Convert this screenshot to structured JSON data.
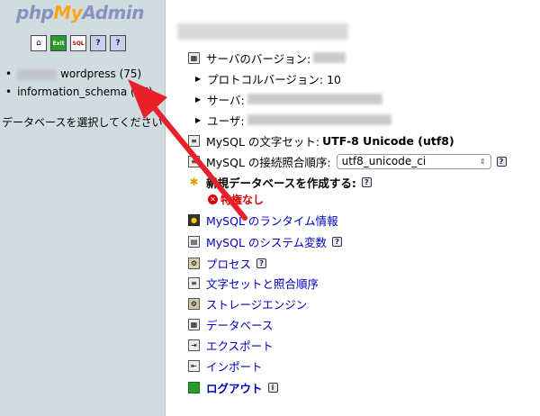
{
  "logo": {
    "php": "php",
    "my": "My",
    "admin": "Admin"
  },
  "iconbar": [
    {
      "name": "home-icon",
      "glyph": "⌂"
    },
    {
      "name": "exit-icon",
      "glyph": "Exit"
    },
    {
      "name": "sql-icon",
      "glyph": "SQL"
    },
    {
      "name": "query-window-icon",
      "glyph": "?"
    },
    {
      "name": "documentation-icon",
      "glyph": "?"
    }
  ],
  "sidebar": {
    "databases": [
      {
        "label": "wordpress (75)"
      },
      {
        "label": "information_schema (17)"
      }
    ],
    "select_message": "データベースを選択してください"
  },
  "main": {
    "server_version": "サーバのバージョン:",
    "protocol_version": "プロトコルバージョン: 10",
    "server": "サーバ:",
    "user": "ユーザ:",
    "charset_label": "MySQL の文字セット:",
    "charset_value": "UTF-8 Unicode (utf8)",
    "collation_label": "MySQL の接続照合順序:",
    "collation_value": "utf8_unicode_ci",
    "create_db": "新規データベースを作成する:",
    "no_privileges": "特権なし",
    "links": [
      "MySQL のランタイム情報",
      "MySQL のシステム変数",
      "プロセス",
      "文字セットと照合順序",
      "ストレージエンジン",
      "データベース",
      "エクスポート",
      "インポート"
    ],
    "logout": "ログアウト"
  },
  "colors": {
    "sidebar_bg": "#d0dce0",
    "link": "#0000c0",
    "arrow": "#e8202a"
  }
}
